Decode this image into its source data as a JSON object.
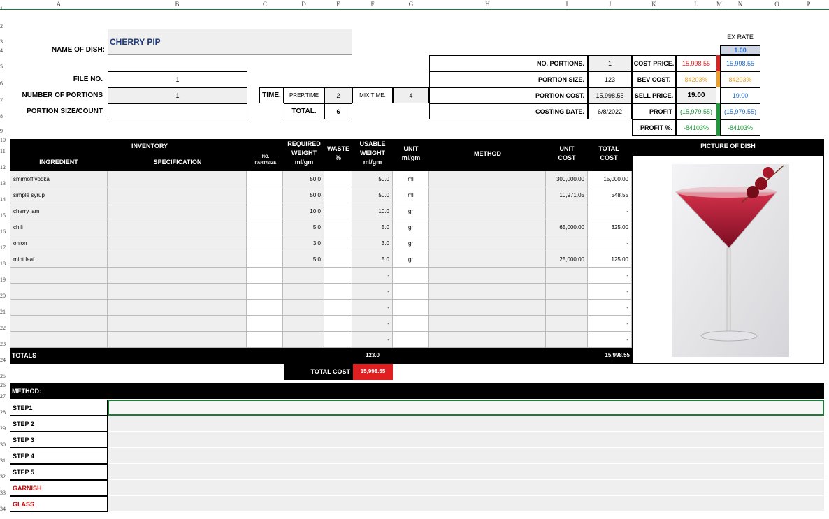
{
  "columns": [
    "A",
    "B",
    "C",
    "D",
    "E",
    "F",
    "G",
    "H",
    "I",
    "J",
    "K",
    "L",
    "M",
    "N",
    "O",
    "P"
  ],
  "rows": [
    "1",
    "2",
    "3",
    "4",
    "5",
    "6",
    "7",
    "8",
    "9",
    "10",
    "11",
    "12",
    "13",
    "14",
    "15",
    "16",
    "17",
    "18",
    "19",
    "20",
    "21",
    "22",
    "23",
    "24",
    "25",
    "26",
    "27",
    "28",
    "29",
    "30",
    "31",
    "32",
    "33",
    "34"
  ],
  "header": {
    "name_label": "NAME OF DISH:",
    "name_value": "CHERRY PIP",
    "file_label": "FILE NO.",
    "file_value": "1",
    "num_portions_label": "NUMBER OF PORTIONS",
    "num_portions_value": "1",
    "portion_size_label": "PORTION SIZE/COUNT",
    "portion_size_value": "",
    "time_label": "TIME.",
    "prep_label": "PREP.TIME",
    "prep_value": "2",
    "mix_label": "MIX TIME.",
    "mix_value": "4",
    "total_label": "TOTAL.",
    "total_value": "6"
  },
  "summary": {
    "no_portions_label": "NO. PORTIONS.",
    "no_portions_value": "1",
    "portion_size_label": "PORTION SIZE.",
    "portion_size_value": "123",
    "portion_cost_label": "PORTION COST.",
    "portion_cost_value": "15,998.55",
    "costing_date_label": "COSTING DATE.",
    "costing_date_value": "6/8/2022",
    "ex_rate_label": "EX RATE",
    "ex_rate_value": "1.00",
    "cost_price_label": "COST PRICE.",
    "cost_price_local": "15,998.55",
    "cost_price_fx": "15,998.55",
    "bev_cost_label": "BEV COST.",
    "bev_cost_local": "84203%",
    "bev_cost_fx": "84203%",
    "sell_price_label": "SELL PRICE.",
    "sell_price_local": "19.00",
    "sell_price_fx": "19.00",
    "profit_label": "PROFIT",
    "profit_local": "(15,979.55)",
    "profit_fx": "(15,979.55)",
    "profit_pct_label": "PROFIT %.",
    "profit_pct_local": "-84103%",
    "profit_pct_fx": "-84103%"
  },
  "table": {
    "h_ingredient": "INGREDIENT",
    "h_inventory": "INVENTORY",
    "h_specification": "SPECIFICATION",
    "h_no1": "NO.",
    "h_no2": "PART/SIZE",
    "h_req1": "REQUIRED",
    "h_req2": "WEIGHT",
    "h_req3": "ml/gm",
    "h_waste1": "WASTE",
    "h_waste2": "%",
    "h_use1": "USABLE",
    "h_use2": "WEIGHT",
    "h_use3": "ml/gm",
    "h_unit1": "UNIT",
    "h_unit2": "ml/gm",
    "h_method": "METHOD",
    "h_ucost1": "UNIT",
    "h_ucost2": "COST",
    "h_tcost1": "TOTAL",
    "h_tcost2": "COST",
    "h_picture": "PICTURE OF DISH",
    "rows": [
      {
        "ingredient": "smirnoff vodka",
        "required": "50.0",
        "usable": "50.0",
        "unit": "ml",
        "unit_cost": "300,000.00",
        "total_cost": "15,000.00"
      },
      {
        "ingredient": "simple syrup",
        "required": "50.0",
        "usable": "50.0",
        "unit": "ml",
        "unit_cost": "10,971.05",
        "total_cost": "548.55"
      },
      {
        "ingredient": "cherry jam",
        "required": "10.0",
        "usable": "10.0",
        "unit": "gr",
        "unit_cost": "",
        "total_cost": "-"
      },
      {
        "ingredient": "chili",
        "required": "5.0",
        "usable": "5.0",
        "unit": "gr",
        "unit_cost": "65,000.00",
        "total_cost": "325.00"
      },
      {
        "ingredient": "onion",
        "required": "3.0",
        "usable": "3.0",
        "unit": "gr",
        "unit_cost": "",
        "total_cost": "-"
      },
      {
        "ingredient": "mint leaf",
        "required": "5.0",
        "usable": "5.0",
        "unit": "gr",
        "unit_cost": "25,000.00",
        "total_cost": "125.00"
      },
      {
        "ingredient": "",
        "required": "",
        "usable": "-",
        "unit": "",
        "unit_cost": "",
        "total_cost": "-"
      },
      {
        "ingredient": "",
        "required": "",
        "usable": "-",
        "unit": "",
        "unit_cost": "",
        "total_cost": "-"
      },
      {
        "ingredient": "",
        "required": "",
        "usable": "-",
        "unit": "",
        "unit_cost": "",
        "total_cost": "-"
      },
      {
        "ingredient": "",
        "required": "",
        "usable": "-",
        "unit": "",
        "unit_cost": "",
        "total_cost": "-"
      },
      {
        "ingredient": "",
        "required": "",
        "usable": "-",
        "unit": "",
        "unit_cost": "",
        "total_cost": "-"
      }
    ],
    "totals_label": "TOTALS",
    "totals_usable": "123.0",
    "totals_cost": "15,998.55",
    "total_cost_label": "TOTAL COST",
    "total_cost_value": "15,998.55"
  },
  "method": {
    "title": "METHOD:",
    "steps": [
      {
        "label": "STEP1",
        "text": ""
      },
      {
        "label": "STEP 2",
        "text": ""
      },
      {
        "label": "STEP 3",
        "text": ""
      },
      {
        "label": "STEP 4",
        "text": ""
      },
      {
        "label": "STEP 5",
        "text": ""
      },
      {
        "label": "GARNISH",
        "text": ""
      },
      {
        "label": "GLASS",
        "text": ""
      }
    ]
  },
  "picture_icon": "cocktail-glass-icon",
  "colors": {
    "grid_green": "#1f7a3a",
    "red": "#e02020",
    "blue": "#1f6fd1",
    "orange": "#f0a020",
    "green": "#1a9a3a",
    "navy": "#1f3a7a",
    "garnish_red": "#c00000"
  }
}
